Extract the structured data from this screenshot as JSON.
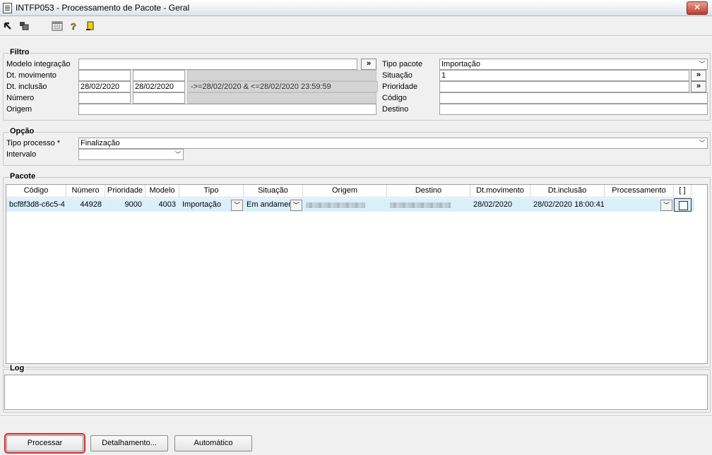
{
  "window": {
    "title": "INTFP053 - Processamento de Pacote - Geral",
    "close_label": "✕"
  },
  "toolbar": {
    "icons": [
      "arrow-icon",
      "windows-icon",
      "calendar-icon",
      "help-icon",
      "exit-icon"
    ]
  },
  "filtro": {
    "legend": "Filtro",
    "modelo_integracao": {
      "label": "Modelo integração",
      "value": "",
      "btn": "»"
    },
    "dt_movimento": {
      "label": "Dt. movimento",
      "from": "",
      "to": "",
      "expr": ""
    },
    "dt_inclusao": {
      "label": "Dt. inclusão",
      "from": "28/02/2020",
      "to": "28/02/2020",
      "expr": "->=28/02/2020 & <=28/02/2020 23:59:59"
    },
    "numero": {
      "label": "Número",
      "from": "",
      "to": "",
      "expr": ""
    },
    "origem": {
      "label": "Origem",
      "value": ""
    },
    "tipo_pacote": {
      "label": "Tipo pacote",
      "value": "Importação"
    },
    "situacao": {
      "label": "Situação",
      "value": "1",
      "btn": "»"
    },
    "prioridade": {
      "label": "Prioridade",
      "value": "",
      "btn": "»"
    },
    "codigo": {
      "label": "Código",
      "value": ""
    },
    "destino": {
      "label": "Destino",
      "value": ""
    }
  },
  "opcao": {
    "legend": "Opção",
    "tipo_processo": {
      "label": "Tipo processo *",
      "value": "Finalização"
    },
    "intervalo": {
      "label": "Intervalo",
      "value": ""
    }
  },
  "pacote": {
    "legend": "Pacote",
    "columns": [
      "Código",
      "Número",
      "Prioridade",
      "Modelo",
      "Tipo",
      "Situação",
      "Origem",
      "Destino",
      "Dt.movimento",
      "Dt.inclusão",
      "Processamento",
      "[ ]"
    ],
    "rows": [
      {
        "codigo": "bcf8f3d8-c6c5-4",
        "numero": "44928",
        "prioridade": "9000",
        "modelo": "4003",
        "tipo": "Importação",
        "situacao": "Em andamen",
        "origem": "",
        "destino": "",
        "dt_movimento": "28/02/2020",
        "dt_inclusao": "28/02/2020 18:00:41",
        "processamento": "",
        "checked": false
      }
    ]
  },
  "log": {
    "legend": "Log",
    "value": ""
  },
  "buttons": {
    "processar": "Processar",
    "detalhamento": "Detalhamento...",
    "automatico": "Automático"
  },
  "colors": {
    "selected_row": "#d9f0fb",
    "highlight": "#e02020"
  }
}
